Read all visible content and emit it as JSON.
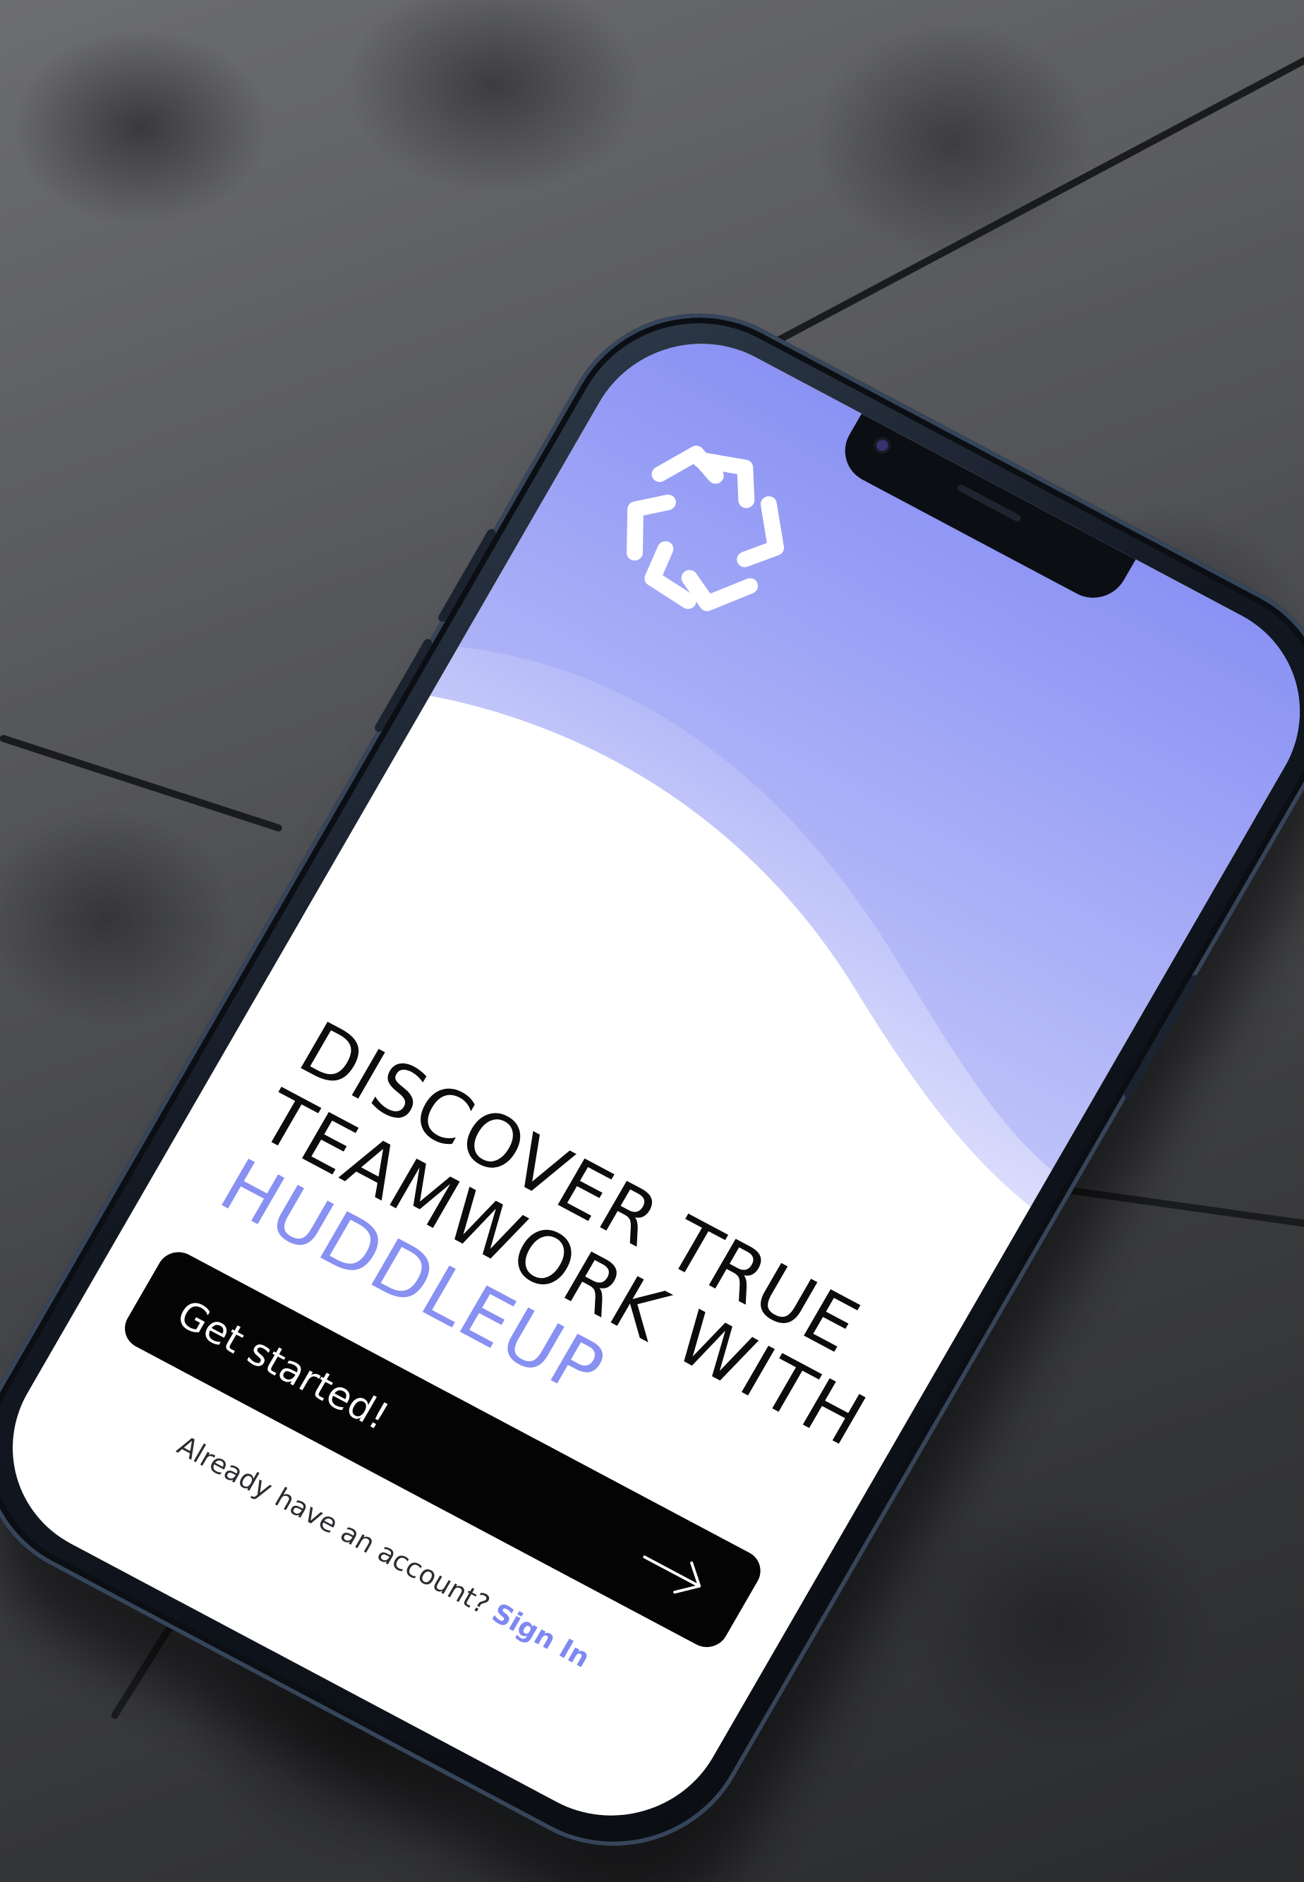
{
  "app": {
    "name": "HuddleUp"
  },
  "logo": {
    "icon": "huddleup-logo-icon",
    "color": "#ffffff"
  },
  "hero": {
    "gradient_top": "#8a92f4",
    "gradient_bottom": "#ffffff"
  },
  "headline": {
    "line1": "DISCOVER TRUE",
    "line2": "TEAMWORK WITH",
    "brand": "HUDDLEUP",
    "brand_color": "#8890f2"
  },
  "cta": {
    "label": "Get started!",
    "icon": "arrow-right-icon",
    "background": "#040405"
  },
  "signin": {
    "prompt": "Already have an account?",
    "link_label": "Sign In",
    "link_color": "#7f88f0"
  }
}
